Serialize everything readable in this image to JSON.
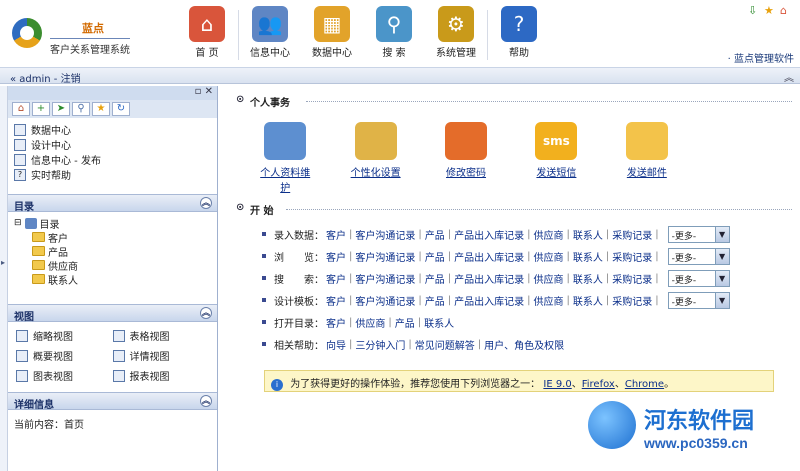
{
  "header": {
    "logo_name": "蓝点",
    "logo_sub": "客户关系管理系统",
    "brand_link": "· 蓝点管理软件",
    "nav": [
      {
        "label": "首 页",
        "icon": "home-icon",
        "color": "#d9553b"
      },
      {
        "label": "信息中心",
        "icon": "users-icon",
        "color": "#5f86c4"
      },
      {
        "label": "数据中心",
        "icon": "grid-icon",
        "color": "#e2a32a"
      },
      {
        "label": "搜 索",
        "icon": "search-icon",
        "color": "#4b95c9"
      },
      {
        "label": "系统管理",
        "icon": "folder-gear-icon",
        "color": "#c99a1a"
      },
      {
        "label": "帮助",
        "icon": "help-icon",
        "color": "#2d69c4"
      }
    ]
  },
  "userbar": {
    "text": "« admin - 注销"
  },
  "left": {
    "quick_items": [
      {
        "label": "数据中心"
      },
      {
        "label": "设计中心"
      },
      {
        "label": "信息中心 - 发布"
      },
      {
        "label": "实时帮助"
      }
    ],
    "catalog_title": "目录",
    "tree": {
      "root": "目录",
      "children": [
        "客户",
        "产品",
        "供应商",
        "联系人"
      ]
    },
    "view_title": "视图",
    "views": [
      "缩略视图",
      "表格视图",
      "概要视图",
      "详情视图",
      "图表视图",
      "报表视图"
    ],
    "detail_title": "详细信息",
    "detail_text": "当前内容：首页"
  },
  "main": {
    "personal_title": "个人事务",
    "personal_items": [
      {
        "label": "个人资料维护",
        "icon": "profile-icon",
        "color": "#5d8fd0"
      },
      {
        "label": "个性化设置",
        "icon": "mac-finder-icon",
        "color": "#e0b347"
      },
      {
        "label": "修改密码",
        "icon": "windows-icon",
        "color": "#e46c2a"
      },
      {
        "label": "发送短信",
        "icon": "sms-icon",
        "color": "#f2b01e"
      },
      {
        "label": "发送邮件",
        "icon": "envelope-icon",
        "color": "#f3c34a"
      }
    ],
    "start_title": "开 始",
    "rows": [
      {
        "label": "录入数据：",
        "links": [
          "客户",
          "客户沟通记录",
          "产品",
          "产品出入库记录",
          "供应商",
          "联系人",
          "采购记录"
        ],
        "select": "-更多-"
      },
      {
        "label": "浏　　览：",
        "links": [
          "客户",
          "客户沟通记录",
          "产品",
          "产品出入库记录",
          "供应商",
          "联系人",
          "采购记录"
        ],
        "select": "-更多-"
      },
      {
        "label": "搜　　索：",
        "links": [
          "客户",
          "客户沟通记录",
          "产品",
          "产品出入库记录",
          "供应商",
          "联系人",
          "采购记录"
        ],
        "select": "-更多-"
      },
      {
        "label": "设计模板：",
        "links": [
          "客户",
          "客户沟通记录",
          "产品",
          "产品出入库记录",
          "供应商",
          "联系人",
          "采购记录"
        ],
        "select": "-更多-"
      },
      {
        "label": "打开目录：",
        "links": [
          "客户",
          "供应商",
          "产品",
          "联系人"
        ],
        "select": ""
      },
      {
        "label": "相关帮助：",
        "links": [
          "向导",
          "三分钟入门",
          "常见问题解答",
          "用户、角色及权限"
        ],
        "select": ""
      }
    ],
    "tip": {
      "text": "为了获得更好的操作体验，推荐您使用下列浏览器之一：",
      "links": [
        "IE 9.0",
        "Firefox",
        "Chrome"
      ],
      "end": "。"
    }
  },
  "watermark": {
    "line1": "河东软件园",
    "line2": "www.pc0359.cn"
  }
}
